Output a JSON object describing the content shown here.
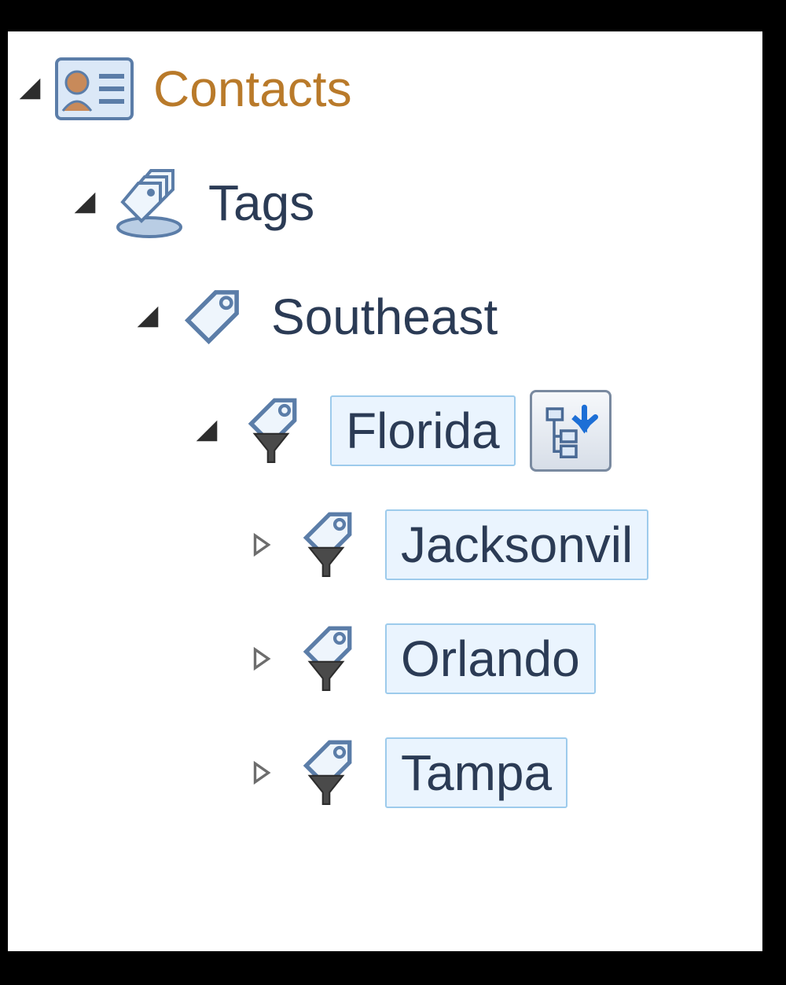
{
  "tree": {
    "root": {
      "label": "Contacts"
    },
    "tags": {
      "label": "Tags"
    },
    "southeast": {
      "label": "Southeast"
    },
    "florida": {
      "label": "Florida"
    },
    "jacksonville": {
      "label": "Jacksonvil"
    },
    "orlando": {
      "label": "Orlando"
    },
    "tampa": {
      "label": "Tampa"
    }
  }
}
